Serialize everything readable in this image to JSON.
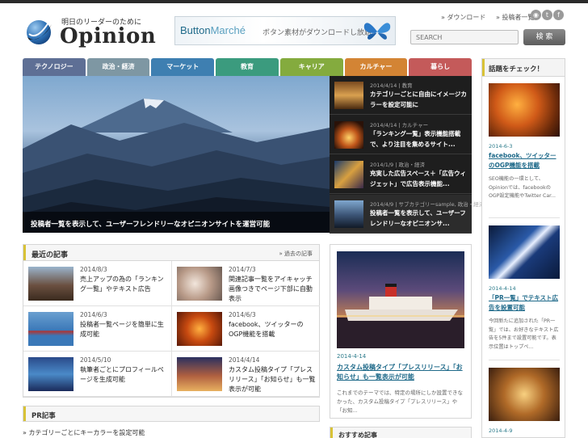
{
  "header": {
    "tagline": "明日のリーダーのために",
    "logo": "Opinion",
    "banner": {
      "brand": "Button",
      "brand2": "Marché",
      "copy": "ボタン素材がダウンロードし放題"
    },
    "links": [
      "» ダウンロード",
      "» 投稿者一覧"
    ],
    "social": [
      "rss-icon",
      "twitter-icon",
      "facebook-icon"
    ],
    "search": {
      "placeholder": "SEARCH",
      "button": "検 索"
    }
  },
  "nav": [
    {
      "label": "テクノロジー",
      "color": "#5e6f95"
    },
    {
      "label": "政治・経済",
      "color": "#7e97a3"
    },
    {
      "label": "マーケット",
      "color": "#3e7fb1"
    },
    {
      "label": "教育",
      "color": "#3b9b7e"
    },
    {
      "label": "キャリア",
      "color": "#84ab3e"
    },
    {
      "label": "カルチャー",
      "color": "#d38434"
    },
    {
      "label": "暮らし",
      "color": "#c45a5a"
    }
  ],
  "hero": {
    "caption": "投稿者一覧を表示して、ユーザーフレンドリーなオピニオンサイトを運営可能"
  },
  "slides": [
    {
      "date": "2014/4/14",
      "cat": "教育",
      "title": "カテゴリーごとに自由にイメージカラーを設定可能に"
    },
    {
      "date": "2014/4/14",
      "cat": "カルチャー",
      "title": "「ランキング一覧」表示機能搭載で、より注目を集めるサイト..."
    },
    {
      "date": "2014/1/9",
      "cat": "政治・経済",
      "title": "充実した広告スペース＋「広告ウィジェット」で広告表示機能..."
    },
    {
      "date": "2014/4/9",
      "cat": "サブカテゴリーsample, 政治・経済",
      "title": "投稿者一覧を表示して、ユーザーフレンドリーなオピニオンサ..."
    }
  ],
  "recent": {
    "heading": "最近の記事",
    "more": "» 過去の記事",
    "items": [
      {
        "date": "2014/8/3",
        "title": "売上アップの為の「ランキング一覧」やテキスト広告"
      },
      {
        "date": "2014/7/3",
        "title": "関連記事一覧をアイキャッチ画像つきでページ下部に自動表示"
      },
      {
        "date": "2014/6/3",
        "title": "投稿者一覧ページを簡単に生成可能"
      },
      {
        "date": "2014/6/3",
        "title": "facebook、ツイッターのOGP機能を搭載"
      },
      {
        "date": "2014/5/10",
        "title": "執筆者ごとにプロフィールページを生成可能"
      },
      {
        "date": "2014/4/14",
        "title": "カスタム投稿タイプ「プレスリリース」「お知らせ」も一覧表示が可能"
      }
    ]
  },
  "pr": {
    "heading": "PR記事",
    "item": "» カテゴリーごとにキーカラーを設定可能"
  },
  "feature": {
    "date": "2014-4-14",
    "title": "カスタム投稿タイプ「プレスリリース」「お知らせ」も一覧表示が可能",
    "desc": "これまでのテーマでは、特定の場所にしか設置できなかった、カスタム投稿タイプ「プレスリリース」や「お知..."
  },
  "osusume": {
    "heading": "おすすめ記事"
  },
  "sidebar": {
    "heading": "話題をチェック！",
    "items": [
      {
        "date": "2014-6-3",
        "title": "facebook、ツイッターのOGP機能を搭載",
        "desc": "SEO機能の一環として、Opinionでは、facebookのOGP設定機能やTwitter Car..."
      },
      {
        "date": "2014-4-14",
        "title": "「PR一覧」でテキスト広告を設置可能",
        "desc": "今回新たに追加された「PR一覧」では、お好きなテキスト広告を5件まで設置可能です。表示位置はトップペ..."
      },
      {
        "date": "2014-4-9",
        "title": "",
        "desc": ""
      }
    ]
  }
}
